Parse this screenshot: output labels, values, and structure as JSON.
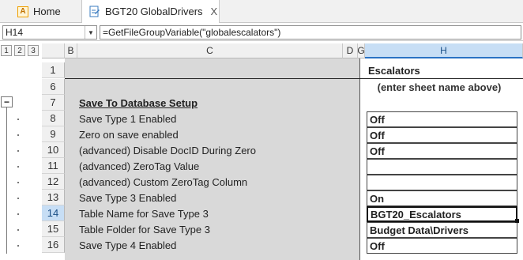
{
  "tabs": [
    {
      "label": "Home",
      "icon": "app-logo-icon",
      "active": false
    },
    {
      "label": "BGT20 GlobalDrivers",
      "icon": "document-icon",
      "active": true,
      "close": "X"
    }
  ],
  "formula_bar": {
    "name_box": "H14",
    "formula": "=GetFileGroupVariable(\"globalescalators\")"
  },
  "outline_levels": [
    "1",
    "2",
    "3"
  ],
  "outline_collapse": "−",
  "columns": [
    {
      "label": "B"
    },
    {
      "label": "C"
    },
    {
      "label": "D"
    },
    {
      "label": "G"
    },
    {
      "label": "H",
      "selected": true
    }
  ],
  "header_rows": [
    {
      "num": "1"
    },
    {
      "num": "6"
    }
  ],
  "h_title": "Escalators",
  "h_note": "(enter sheet name above)",
  "rows": [
    {
      "num": "7",
      "label": "Save To Database Setup",
      "section": true,
      "value": null
    },
    {
      "num": "8",
      "label": "Save Type 1 Enabled",
      "value": "Off"
    },
    {
      "num": "9",
      "label": "Zero on save enabled",
      "value": "Off"
    },
    {
      "num": "10",
      "label": "(advanced) Disable DocID During Zero",
      "value": "Off"
    },
    {
      "num": "11",
      "label": "(advanced) ZeroTag Value",
      "value": ""
    },
    {
      "num": "12",
      "label": "(advanced) Custom ZeroTag Column",
      "value": ""
    },
    {
      "num": "13",
      "label": "Save Type 3 Enabled",
      "value": "On"
    },
    {
      "num": "14",
      "label": "Table Name for Save Type 3",
      "value": "BGT20_Escalators",
      "selected": true
    },
    {
      "num": "15",
      "label": "Table Folder for Save Type 3",
      "value": "Budget Data\\Drivers"
    },
    {
      "num": "16",
      "label": "Save Type 4 Enabled",
      "value": "Off"
    }
  ]
}
